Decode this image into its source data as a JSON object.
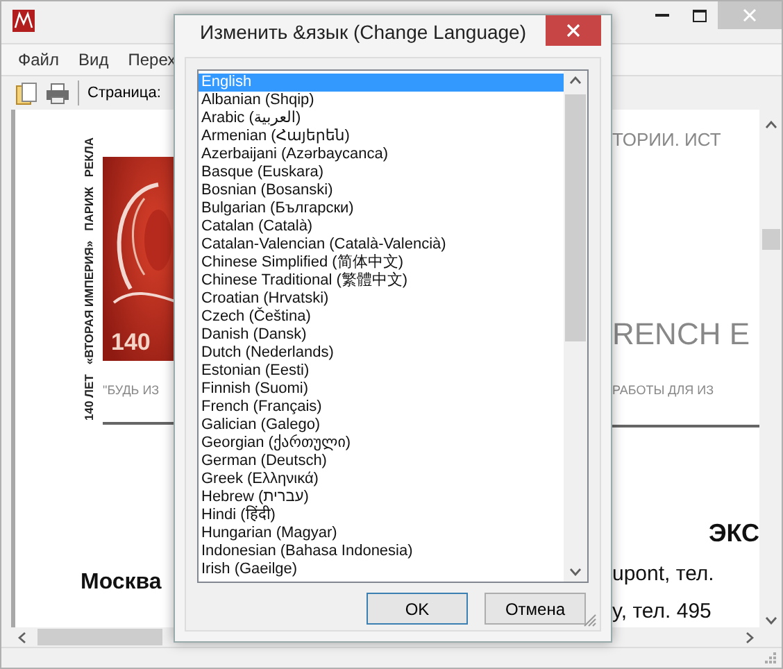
{
  "app": {
    "menu": [
      "Файл",
      "Вид",
      "Перех"
    ],
    "toolbar": {
      "page_label": "Страница:"
    },
    "document": {
      "side_strip": [
        "140 ЛЕТ",
        "«ВТОРАЯ ИМПЕРИЯ»",
        "ПАРИЖ",
        "РЕКЛА"
      ],
      "logo_text": "140",
      "left_caption": "\"БУДЬ ИЗ",
      "left_heading": "Москва",
      "right_lines": [
        {
          "kind": "caps",
          "text": "ТОРИИ. ИСТ"
        },
        {
          "kind": "large",
          "text": "RENCH E"
        },
        {
          "kind": "small",
          "text": "РАБОТЫ ДЛЯ ИЗ"
        },
        {
          "kind": "rule"
        },
        {
          "kind": "heading",
          "text": "ЭКС"
        },
        {
          "kind": "body",
          "text": "upont, тел."
        },
        {
          "kind": "body",
          "text": "y, тел. 495"
        }
      ]
    }
  },
  "dialog": {
    "title": "Изменить &язык (Change Language)",
    "languages": [
      {
        "label": "English",
        "selected": true
      },
      {
        "label": "Albanian (Shqip)",
        "selected": false
      },
      {
        "label": "Arabic (العربية)",
        "selected": false
      },
      {
        "label": "Armenian (Հայերեն)",
        "selected": false
      },
      {
        "label": "Azerbaijani (Azərbaycanca)",
        "selected": false
      },
      {
        "label": "Basque (Euskara)",
        "selected": false
      },
      {
        "label": "Bosnian (Bosanski)",
        "selected": false
      },
      {
        "label": "Bulgarian (Български)",
        "selected": false
      },
      {
        "label": "Catalan (Català)",
        "selected": false
      },
      {
        "label": "Catalan-Valencian (Català-Valencià)",
        "selected": false
      },
      {
        "label": "Chinese Simplified (简体中文)",
        "selected": false
      },
      {
        "label": "Chinese Traditional (繁體中文)",
        "selected": false
      },
      {
        "label": "Croatian (Hrvatski)",
        "selected": false
      },
      {
        "label": "Czech (Čeština)",
        "selected": false
      },
      {
        "label": "Danish (Dansk)",
        "selected": false
      },
      {
        "label": "Dutch (Nederlands)",
        "selected": false
      },
      {
        "label": "Estonian (Eesti)",
        "selected": false
      },
      {
        "label": "Finnish (Suomi)",
        "selected": false
      },
      {
        "label": "French (Français)",
        "selected": false
      },
      {
        "label": "Galician (Galego)",
        "selected": false
      },
      {
        "label": "Georgian (ქართული)",
        "selected": false
      },
      {
        "label": "German (Deutsch)",
        "selected": false
      },
      {
        "label": "Greek (Ελληνικά)",
        "selected": false
      },
      {
        "label": "Hebrew (עברית)",
        "selected": false
      },
      {
        "label": "Hindi (हिंदी)",
        "selected": false
      },
      {
        "label": "Hungarian (Magyar)",
        "selected": false
      },
      {
        "label": "Indonesian (Bahasa Indonesia)",
        "selected": false
      },
      {
        "label": "Irish (Gaeilge)",
        "selected": false
      }
    ],
    "buttons": [
      {
        "label": "OK",
        "default": true
      },
      {
        "label": "Отмена",
        "default": false
      }
    ]
  }
}
